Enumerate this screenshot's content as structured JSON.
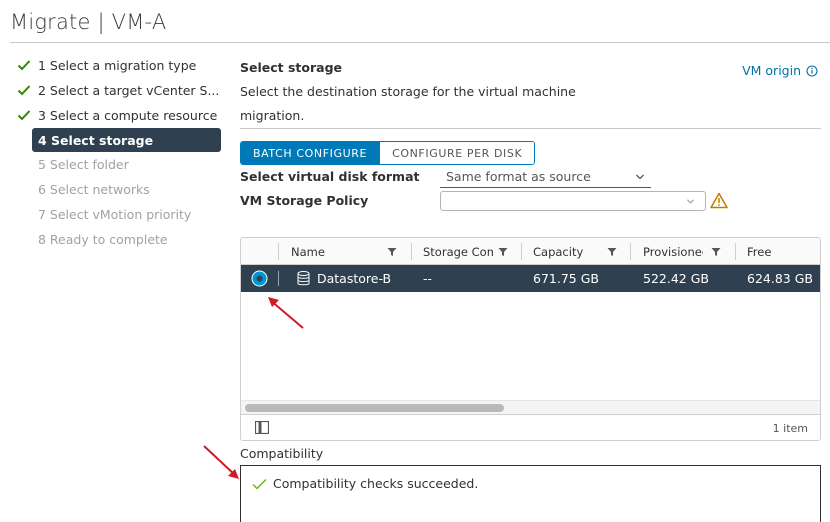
{
  "window": {
    "title": "Migrate | VM-A"
  },
  "steps": [
    {
      "label": "1 Select a migration type",
      "state": "done"
    },
    {
      "label": "2 Select a target vCenter S...",
      "state": "done"
    },
    {
      "label": "3 Select a compute resource",
      "state": "done"
    },
    {
      "label": "4 Select storage",
      "state": "active"
    },
    {
      "label": "5 Select folder",
      "state": "pending"
    },
    {
      "label": "6 Select networks",
      "state": "pending"
    },
    {
      "label": "7 Select vMotion priority",
      "state": "pending"
    },
    {
      "label": "8 Ready to complete",
      "state": "pending"
    }
  ],
  "main": {
    "title": "Select storage",
    "description": "Select the destination storage for the virtual machine migration.",
    "vm_origin_link": "VM origin",
    "tabs": {
      "batch": "BATCH CONFIGURE",
      "per_disk": "CONFIGURE PER DISK"
    },
    "disk_format": {
      "label": "Select virtual disk format",
      "value": "Same format as source"
    },
    "storage_policy": {
      "label": "VM Storage Policy",
      "value": ""
    }
  },
  "grid": {
    "columns": [
      "Name",
      "Storage Com",
      "Capacity",
      "Provisioned",
      "Free"
    ],
    "rows": [
      {
        "name": "Datastore-B",
        "storage_compat": "--",
        "capacity": "671.75 GB",
        "provisioned": "522.42 GB",
        "free": "624.83 GB"
      }
    ],
    "footer": {
      "count": "1 item"
    }
  },
  "compatibility": {
    "label": "Compatibility",
    "message": "Compatibility checks succeeded."
  },
  "colors": {
    "accent": "#0079b8",
    "selected_row": "#2f4150",
    "success": "#60b515",
    "warning": "#c27b00",
    "annotation": "#d2182b"
  },
  "icons": [
    "check-icon",
    "info-icon",
    "chevron-down-icon",
    "warning-icon",
    "filter-icon",
    "radio-icon",
    "database-icon",
    "column-toggle-icon",
    "annotation-arrow"
  ]
}
